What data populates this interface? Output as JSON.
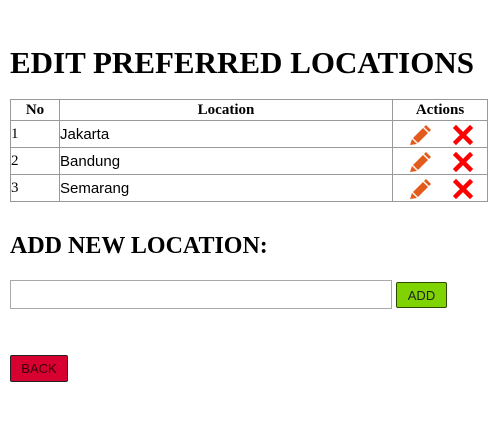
{
  "page": {
    "title": "EDIT PREFERRED LOCATIONS"
  },
  "table": {
    "headers": {
      "no": "No",
      "location": "Location",
      "actions": "Actions"
    },
    "rows": [
      {
        "no": "1",
        "location": "Jakarta"
      },
      {
        "no": "2",
        "location": "Bandung"
      },
      {
        "no": "3",
        "location": "Semarang"
      }
    ],
    "actions": {
      "edit_icon": "pencil-icon",
      "delete_icon": "close-x-icon"
    }
  },
  "add_section": {
    "title": "ADD NEW LOCATION:",
    "input_value": "",
    "add_label": "ADD"
  },
  "back_label": "BACK",
  "colors": {
    "edit_icon": "#e35b1c",
    "delete_icon": "#ff0000",
    "add_button": "#7ed300",
    "back_button": "#d80030"
  }
}
